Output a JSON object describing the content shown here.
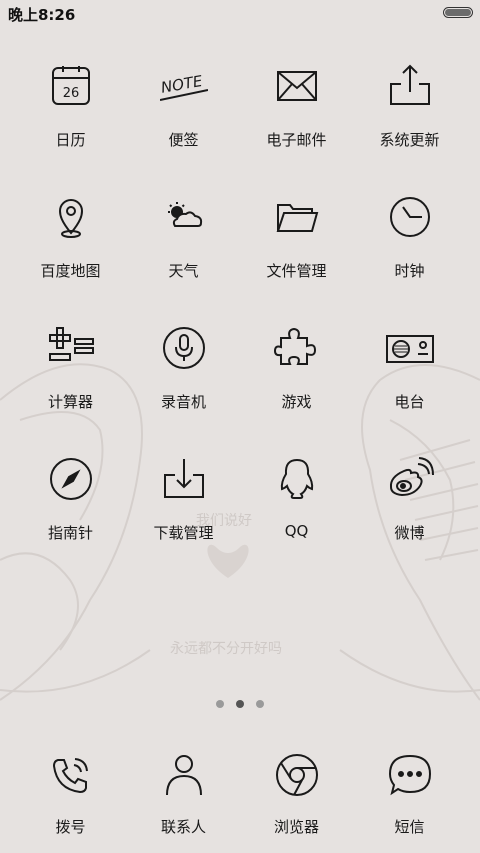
{
  "status_bar": {
    "time": "晚上8:26",
    "battery_level": 1.0
  },
  "wallpaper": {
    "text_top": "我们说好",
    "text_bottom": "永远都不分开好吗"
  },
  "calendar_day": "26",
  "note_text": "NOTE",
  "apps": [
    {
      "label": "日历",
      "icon": "calendar-icon"
    },
    {
      "label": "便签",
      "icon": "note-icon"
    },
    {
      "label": "电子邮件",
      "icon": "mail-icon"
    },
    {
      "label": "系统更新",
      "icon": "upload-icon"
    },
    {
      "label": "百度地图",
      "icon": "map-pin-icon"
    },
    {
      "label": "天气",
      "icon": "weather-icon"
    },
    {
      "label": "文件管理",
      "icon": "folder-icon"
    },
    {
      "label": "时钟",
      "icon": "clock-icon"
    },
    {
      "label": "计算器",
      "icon": "calculator-icon"
    },
    {
      "label": "录音机",
      "icon": "microphone-icon"
    },
    {
      "label": "游戏",
      "icon": "puzzle-icon"
    },
    {
      "label": "电台",
      "icon": "radio-icon"
    },
    {
      "label": "指南针",
      "icon": "compass-icon"
    },
    {
      "label": "下载管理",
      "icon": "download-icon"
    },
    {
      "label": "QQ",
      "icon": "qq-penguin-icon"
    },
    {
      "label": "微博",
      "icon": "weibo-icon"
    }
  ],
  "dock": [
    {
      "label": "拨号",
      "icon": "phone-icon"
    },
    {
      "label": "联系人",
      "icon": "contact-icon"
    },
    {
      "label": "浏览器",
      "icon": "browser-icon"
    },
    {
      "label": "短信",
      "icon": "message-icon"
    }
  ],
  "page_indicator": {
    "pages": 3,
    "current": 2
  }
}
